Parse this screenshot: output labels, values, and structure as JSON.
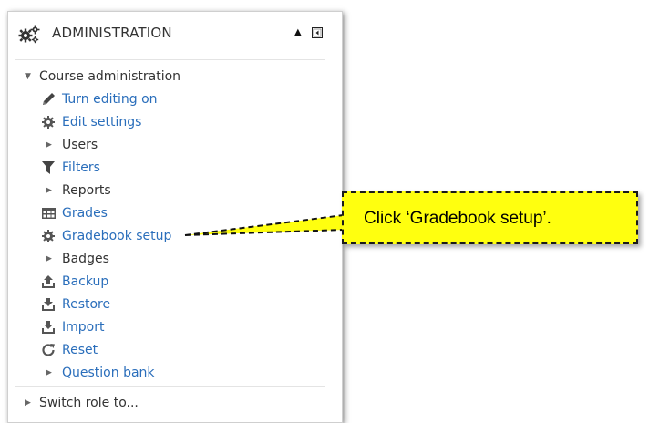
{
  "block": {
    "title": "ADMINISTRATION",
    "collapse_glyph": "▲"
  },
  "course_admin": {
    "label": "Course administration",
    "items": [
      {
        "label": "Turn editing on",
        "icon": "pencil-icon",
        "type": "link"
      },
      {
        "label": "Edit settings",
        "icon": "cog-icon",
        "type": "link"
      },
      {
        "label": "Users",
        "icon": "caret-right-icon",
        "type": "branch"
      },
      {
        "label": "Filters",
        "icon": "filter-icon",
        "type": "link"
      },
      {
        "label": "Reports",
        "icon": "caret-right-icon",
        "type": "branch"
      },
      {
        "label": "Grades",
        "icon": "table-icon",
        "type": "link"
      },
      {
        "label": "Gradebook setup",
        "icon": "cog-icon",
        "type": "link"
      },
      {
        "label": "Badges",
        "icon": "caret-right-icon",
        "type": "branch"
      },
      {
        "label": "Backup",
        "icon": "upload-icon",
        "type": "link"
      },
      {
        "label": "Restore",
        "icon": "download-icon",
        "type": "link"
      },
      {
        "label": "Import",
        "icon": "download-icon",
        "type": "link"
      },
      {
        "label": "Reset",
        "icon": "refresh-icon",
        "type": "link"
      },
      {
        "label": "Question bank",
        "icon": "caret-right-icon",
        "type": "branch"
      }
    ]
  },
  "switch_role": {
    "label": "Switch role to..."
  },
  "callout": {
    "text": "Click ‘Gradebook setup’."
  },
  "colors": {
    "link": "#2a6ebb",
    "callout_bg": "#ffff0f"
  }
}
